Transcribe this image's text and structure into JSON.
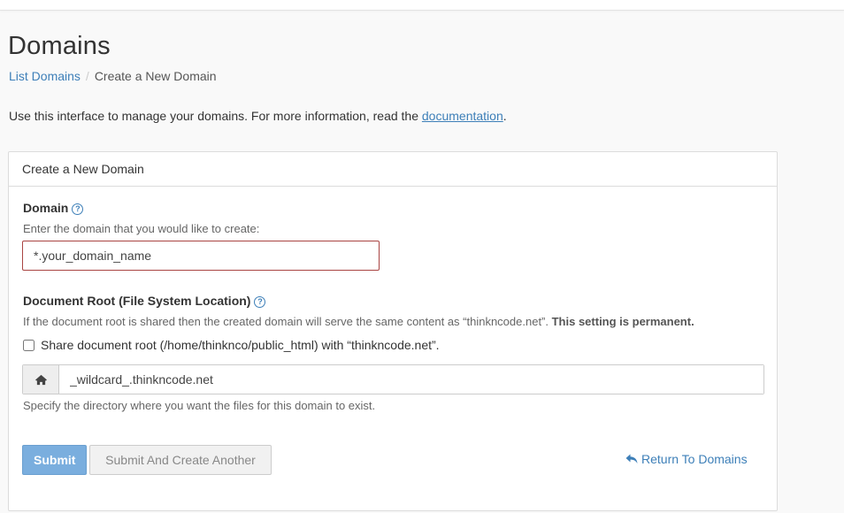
{
  "header": {
    "title": "Domains",
    "breadcrumb": {
      "parent": "List Domains",
      "separator": "/",
      "current": "Create a New Domain"
    },
    "intro_text": "Use this interface to manage your domains. For more information, read the ",
    "intro_link": "documentation",
    "intro_end": "."
  },
  "panel": {
    "heading": "Create a New Domain",
    "domain": {
      "label": "Domain",
      "help_icon": "?",
      "hint": "Enter the domain that you would like to create:",
      "value": "*.your_domain_name"
    },
    "docroot": {
      "label": "Document Root (File System Location)",
      "help_icon": "?",
      "hint": "If the document root is shared then the created domain will serve the same content as “thinkncode.net”. ",
      "hint_bold": "This setting is permanent.",
      "share_checkbox_label": "Share document root (/home/thinknco/public_html) with “thinkncode.net”.",
      "share_checked": false,
      "addon_icon": "home-icon",
      "value": "_wildcard_.thinkncode.net",
      "footer_hint": "Specify the directory where you want the files for this domain to exist."
    },
    "actions": {
      "submit": "Submit",
      "submit_another": "Submit And Create Another",
      "return_icon": "reply-arrow-icon",
      "return_link": "Return To Domains"
    }
  },
  "colors": {
    "link": "#3d7fb8",
    "primary_button": "#7aaede",
    "error_border": "#a94442",
    "page_background": "#f9f9f9"
  }
}
